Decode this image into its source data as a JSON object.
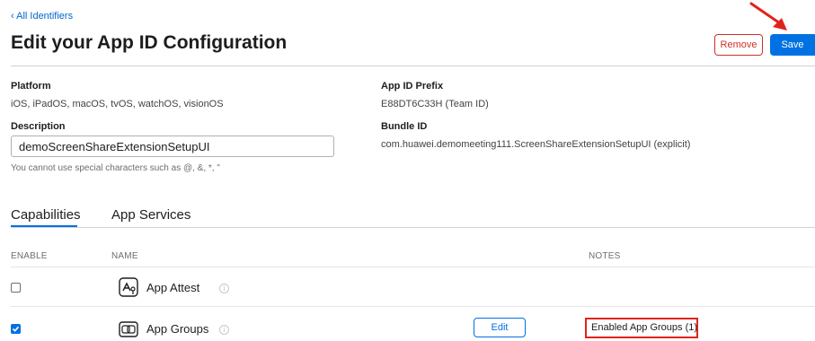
{
  "header": {
    "back_link": "‹ All Identifiers",
    "title": "Edit your App ID Configuration",
    "remove_label": "Remove",
    "save_label": "Save"
  },
  "details": {
    "platform_label": "Platform",
    "platform_value": "iOS, iPadOS, macOS, tvOS, watchOS, visionOS",
    "prefix_label": "App ID Prefix",
    "prefix_value": "E88DT6C33H (Team ID)",
    "description_label": "Description",
    "description_value": "demoScreenShareExtensionSetupUI",
    "description_hint": "You cannot use special characters such as @, &, *, \"",
    "bundle_label": "Bundle ID",
    "bundle_value": "com.huawei.demomeeting111.ScreenShareExtensionSetupUI (explicit)"
  },
  "tabs": [
    {
      "label": "Capabilities",
      "active": true
    },
    {
      "label": "App Services",
      "active": false
    }
  ],
  "table": {
    "headers": {
      "enable": "ENABLE",
      "name": "NAME",
      "notes": "NOTES"
    },
    "rows": [
      {
        "name": "App Attest",
        "icon": "app-attest-icon",
        "checked": false,
        "edit": "",
        "notes": ""
      },
      {
        "name": "App Groups",
        "icon": "app-groups-icon",
        "checked": true,
        "edit": "Edit",
        "notes": "Enabled App Groups (1)"
      }
    ]
  },
  "colors": {
    "accent": "#0071e3",
    "destructive": "#d0302a",
    "annotation": "#e0241b"
  }
}
